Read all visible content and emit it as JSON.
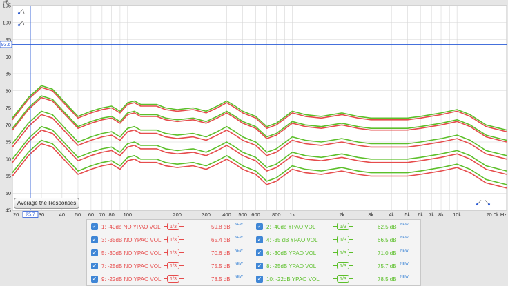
{
  "chart_data": {
    "type": "line",
    "title": "",
    "ylabel": "dB",
    "xlabel": "",
    "x_unit": "Hz",
    "x_scale": "log",
    "xlim": [
      20,
      20000
    ],
    "ylim": [
      45,
      105
    ],
    "grid": true,
    "y_ticks": [
      "45",
      "50",
      "55",
      "60",
      "65",
      "70",
      "75",
      "80",
      "85",
      "90",
      "95",
      "100",
      "105"
    ],
    "x_ticks": [
      {
        "value": 20,
        "label": "20"
      },
      {
        "value": 30,
        "label": "30"
      },
      {
        "value": 40,
        "label": "40"
      },
      {
        "value": 50,
        "label": "50"
      },
      {
        "value": 60,
        "label": "60"
      },
      {
        "value": 70,
        "label": "70"
      },
      {
        "value": 80,
        "label": "80"
      },
      {
        "value": 100,
        "label": "100"
      },
      {
        "value": 200,
        "label": "200"
      },
      {
        "value": 300,
        "label": "300"
      },
      {
        "value": 400,
        "label": "400"
      },
      {
        "value": 500,
        "label": "500"
      },
      {
        "value": 600,
        "label": "600"
      },
      {
        "value": 800,
        "label": "800"
      },
      {
        "value": 1000,
        "label": "1k"
      },
      {
        "value": 2000,
        "label": "2k"
      },
      {
        "value": 3000,
        "label": "3k"
      },
      {
        "value": 4000,
        "label": "4k"
      },
      {
        "value": 5000,
        "label": "5k"
      },
      {
        "value": 6000,
        "label": "6k"
      },
      {
        "value": 7000,
        "label": "7k"
      },
      {
        "value": 8000,
        "label": "8k"
      },
      {
        "value": 10000,
        "label": "10k"
      },
      {
        "value": 20000,
        "label": "20.0k Hz"
      }
    ],
    "cursor": {
      "x": 25.7,
      "x_label": "25.7",
      "y": 93.6,
      "y_label": "93.6"
    },
    "x": [
      20,
      25,
      30,
      35,
      40,
      50,
      60,
      70,
      80,
      90,
      100,
      110,
      120,
      150,
      170,
      200,
      250,
      300,
      350,
      400,
      450,
      500,
      600,
      700,
      800,
      1000,
      1200,
      1500,
      2000,
      2500,
      3000,
      4000,
      5000,
      6000,
      8000,
      10000,
      12000,
      15000,
      20000
    ],
    "base": [
      62,
      68,
      71.5,
      70.5,
      67.5,
      62.5,
      64,
      65,
      65.5,
      64,
      66.5,
      67,
      66,
      66,
      65,
      64.5,
      65,
      64,
      65.5,
      67,
      65.5,
      64,
      62.5,
      59.5,
      60.5,
      64,
      63,
      62.5,
      63.5,
      62.5,
      62,
      62,
      62,
      62.5,
      63.5,
      64.5,
      63,
      60,
      58.5
    ],
    "series": [
      {
        "name": "1: -40db NO YPAO VOL",
        "offset": -7,
        "color": "#e64c4c",
        "level": "59.8 dB"
      },
      {
        "name": "2: -40db YPAO VOL",
        "offset": -6,
        "color": "#5cbf2a",
        "level": "62.5 dB"
      },
      {
        "name": "3: -35dB NO YPAO VOL",
        "offset": -3,
        "color": "#e64c4c",
        "level": "65.4 dB"
      },
      {
        "name": "4: -35 dB YPAO VOL",
        "offset": -2,
        "color": "#5cbf2a",
        "level": "66.5 dB"
      },
      {
        "name": "5: -30dB NO YPAO VOL",
        "offset": 1.5,
        "color": "#e64c4c",
        "level": "70.6 dB"
      },
      {
        "name": "6: -30dB YPAO VOL",
        "offset": 2.5,
        "color": "#5cbf2a",
        "level": "71.0 dB"
      },
      {
        "name": "7: -25dB NO YPAO VOL",
        "offset": 6.5,
        "color": "#e64c4c",
        "level": "75.5 dB"
      },
      {
        "name": "8: -25dB YPAO VOL",
        "offset": 7,
        "color": "#5cbf2a",
        "level": "75.7 dB"
      },
      {
        "name": "9: -22dB NO YPAO VOL",
        "offset": 9.5,
        "color": "#e64c4c",
        "level": "78.5 dB"
      },
      {
        "name": "10: -22dB YPAO VOL",
        "offset": 10,
        "color": "#5cbf2a",
        "level": "78.5 dB"
      }
    ]
  },
  "ui": {
    "average_button": "Average the Responses",
    "smoothing_label": "1/3",
    "new_badge": "NEW",
    "check_mark": "✓"
  },
  "colors": {
    "red": "#e64c4c",
    "green": "#5cbf2a",
    "cursor": "#2a5bd7",
    "accent": "#3f86d6"
  }
}
